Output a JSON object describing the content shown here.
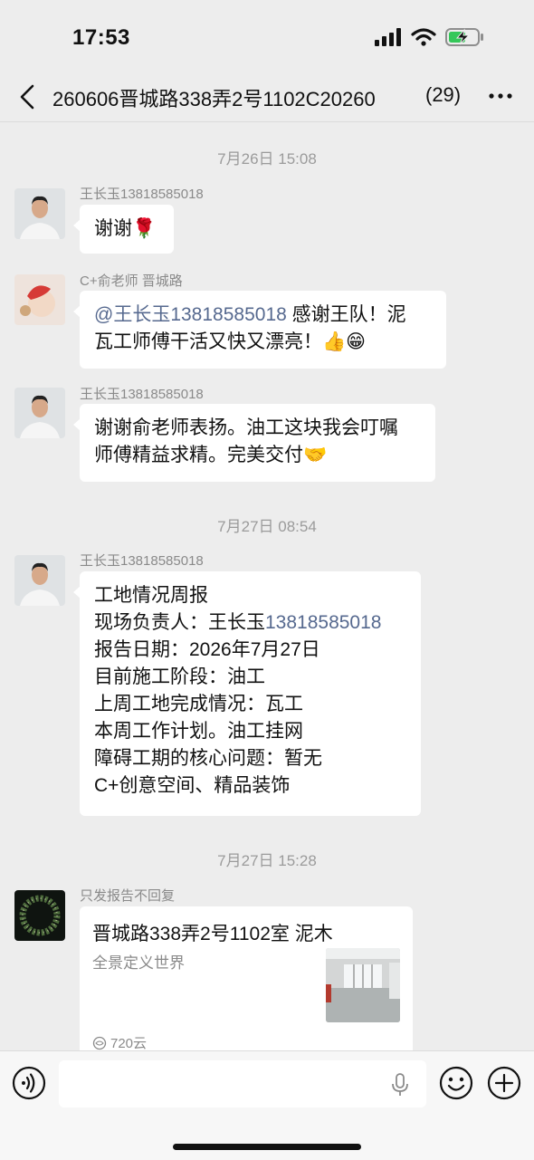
{
  "status": {
    "time": "17:53"
  },
  "header": {
    "title": "260606晋城路338弄2号1102C20260",
    "count": "(29)"
  },
  "timestamps": [
    "7月26日 15:08",
    "7月27日 08:54",
    "7月27日 15:28"
  ],
  "messages": [
    {
      "sender": "王长玉13818585018",
      "text": "谢谢",
      "emoji": "🌹"
    },
    {
      "sender": "C+俞老师 晋城路",
      "mention": "@王长玉",
      "phone": "13818585018",
      "text_a": " 感谢王队！泥",
      "text_b": "瓦工师傅干活又快又漂亮！",
      "emoji": "👍😁"
    },
    {
      "sender": "王长玉13818585018",
      "line1": "谢谢俞老师表扬。油工这块我会叮嘱",
      "line2": "师傅精益求精。完美交付",
      "emoji": "🤝"
    },
    {
      "sender": "王长玉13818585018",
      "lines": [
        "工地情况周报",
        "现场负责人：王长玉",
        "报告日期：2026年7月27日",
        "目前施工阶段：油工",
        "上周工地完成情况：瓦工",
        "本周工作计划。油工挂网",
        "障碍工期的核心问题：暂无",
        "C+创意空间、精品装饰"
      ],
      "phone": "13818585018"
    }
  ],
  "card_message": {
    "sender": "只发报告不回复",
    "title": "晋城路338弄2号1102室 泥木",
    "description": "全景定义世界",
    "source": "720云",
    "source_icon": "720-logo-icon"
  },
  "colors": {
    "background": "#ededed",
    "bubble": "#ffffff",
    "link": "#56698f",
    "muted": "#8a8a8a"
  }
}
